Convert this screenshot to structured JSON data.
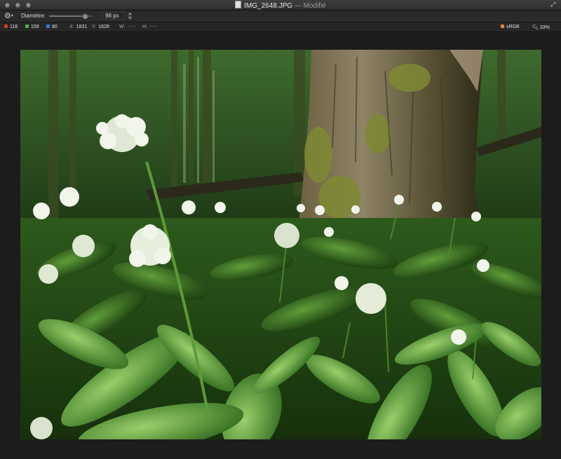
{
  "window": {
    "title": "IMG_2648.JPG",
    "modified": "— Modifié"
  },
  "toolbar": {
    "diameter_label": "Diamètre:",
    "diameter_value": "98 px",
    "diameter_fraction": 0.82
  },
  "info": {
    "r_label": "R:",
    "r_value": "118",
    "g_label": "G:",
    "g_value": "159",
    "b_label": "B:",
    "b_value": "80",
    "x_label": "X:",
    "x_value": "1831",
    "y_label": "Y:",
    "y_value": "1628",
    "w_label": "W:",
    "w_value": "-----",
    "h_label": "H:",
    "h_value": "-----",
    "color_profile": "sRGB",
    "zoom": "33%"
  },
  "colors": {
    "accent_red": "#d23a2a",
    "accent_green": "#4fb04a",
    "accent_blue": "#3a78d6"
  },
  "icons": [
    "gear-icon",
    "document-icon",
    "fullscreen-icon",
    "srgb-icon",
    "zoom-icon"
  ]
}
